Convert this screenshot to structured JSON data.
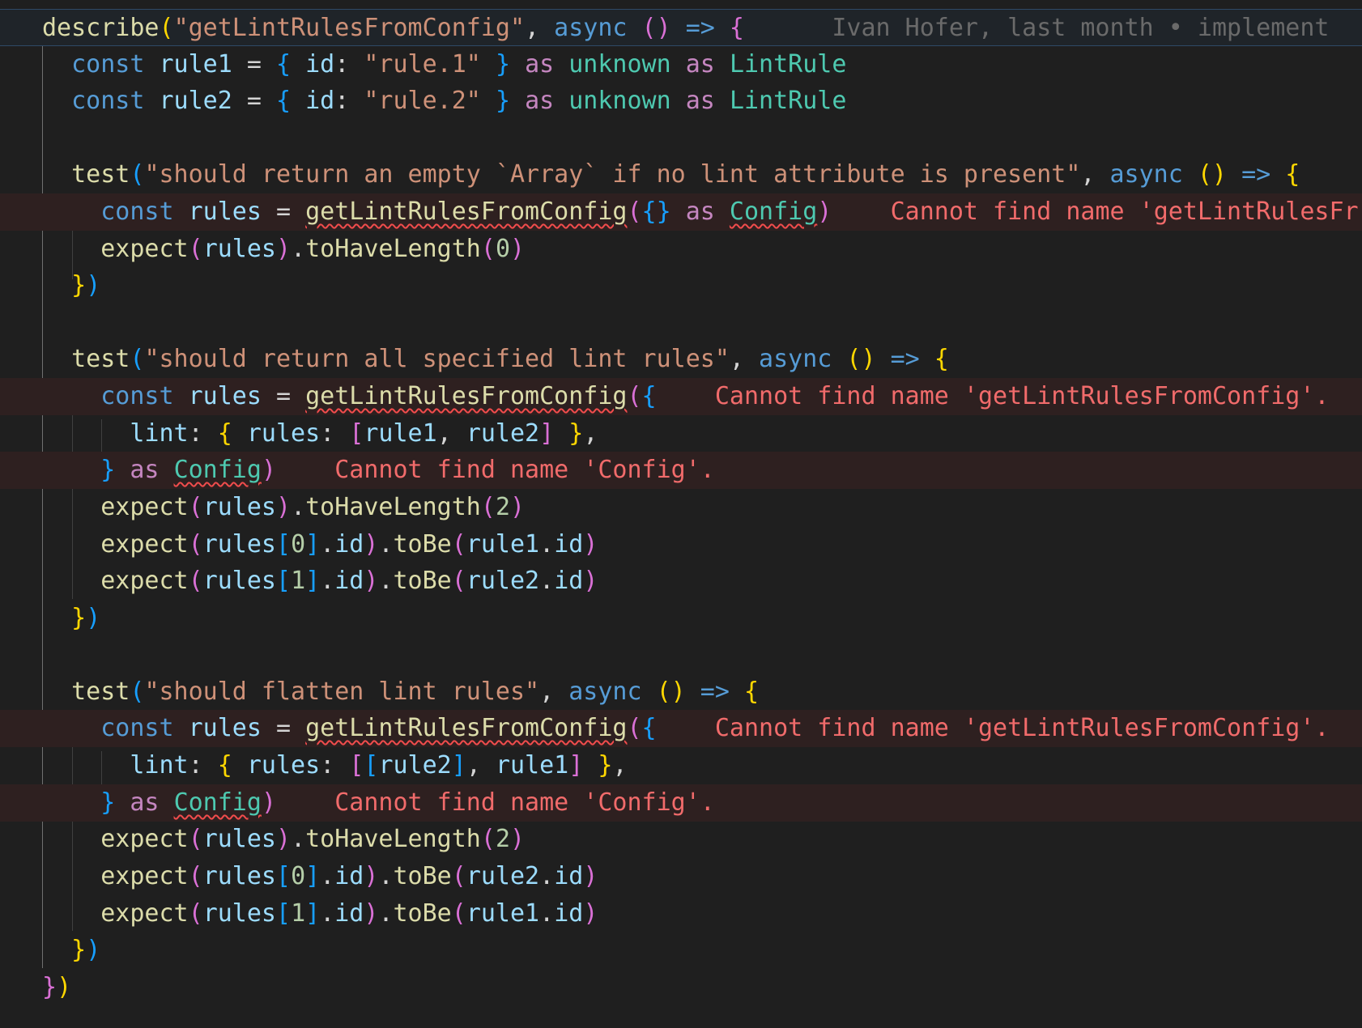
{
  "editor": {
    "blame": "Ivan Hofer, last month • implement",
    "describe_name": "\"getLintRulesFromConfig\"",
    "rule1_def": {
      "name": "rule1",
      "id_value": "\"rule.1\"",
      "type": "LintRule"
    },
    "rule2_def": {
      "name": "rule2",
      "id_value": "\"rule.2\"",
      "type": "LintRule"
    },
    "tests": [
      {
        "title": "\"should return an empty `Array` if no lint attribute is present\"",
        "errors": [
          "Cannot find name 'getLintRulesFr"
        ],
        "length": "0"
      },
      {
        "title": "\"should return all specified lint rules\"",
        "errors": [
          "Cannot find name 'getLintRulesFromConfig'.",
          "Cannot find name 'Config'."
        ],
        "length": "2"
      },
      {
        "title": "\"should flatten lint rules\"",
        "errors": [
          "Cannot find name 'getLintRulesFromConfig'.",
          "Cannot find name 'Config'."
        ],
        "length": "2"
      }
    ],
    "colors": {
      "background": "#1f1f1f",
      "error_line_bg": "#2e2020",
      "error_text": "#f16b6b",
      "keyword": "#569cd6",
      "function": "#dcdcaa",
      "string": "#ce9178",
      "type": "#4ec9b0"
    }
  }
}
